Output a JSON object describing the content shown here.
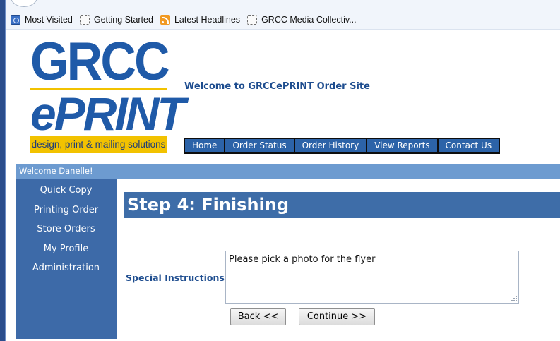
{
  "bookmarks": [
    {
      "label": "Most Visited",
      "icon": "most-visited-icon"
    },
    {
      "label": "Getting Started",
      "icon": "page-icon"
    },
    {
      "label": "Latest Headlines",
      "icon": "rss-icon"
    },
    {
      "label": "GRCC Media Collectiv...",
      "icon": "page-icon"
    }
  ],
  "logo": {
    "line1": "GRCC",
    "line2": "ePRINT",
    "tagline": "design, print & mailing solutions"
  },
  "site": {
    "welcome_title": "Welcome to GRCCePRINT Order Site"
  },
  "topnav": {
    "items": [
      "Home",
      "Order Status",
      "Order History",
      "View Reports",
      "Contact Us"
    ]
  },
  "user": {
    "welcome": "Welcome Danelle!"
  },
  "sidebar": {
    "items": [
      "Quick Copy",
      "Printing Order",
      "Store Orders",
      "My Profile",
      "Administration"
    ]
  },
  "step": {
    "title": "Step 4: Finishing"
  },
  "form": {
    "special_instructions_label": "Special Instructions",
    "special_instructions_value": "Please pick a photo for the flyer",
    "back_label": "Back <<",
    "continue_label": "Continue >>"
  },
  "colors": {
    "brand_blue": "#1f5aa8",
    "brand_yellow": "#f2c200",
    "nav_blue": "#2c63a8",
    "sidebar_blue": "#3d6aa8",
    "welcome_bar": "#6d9bd0"
  }
}
